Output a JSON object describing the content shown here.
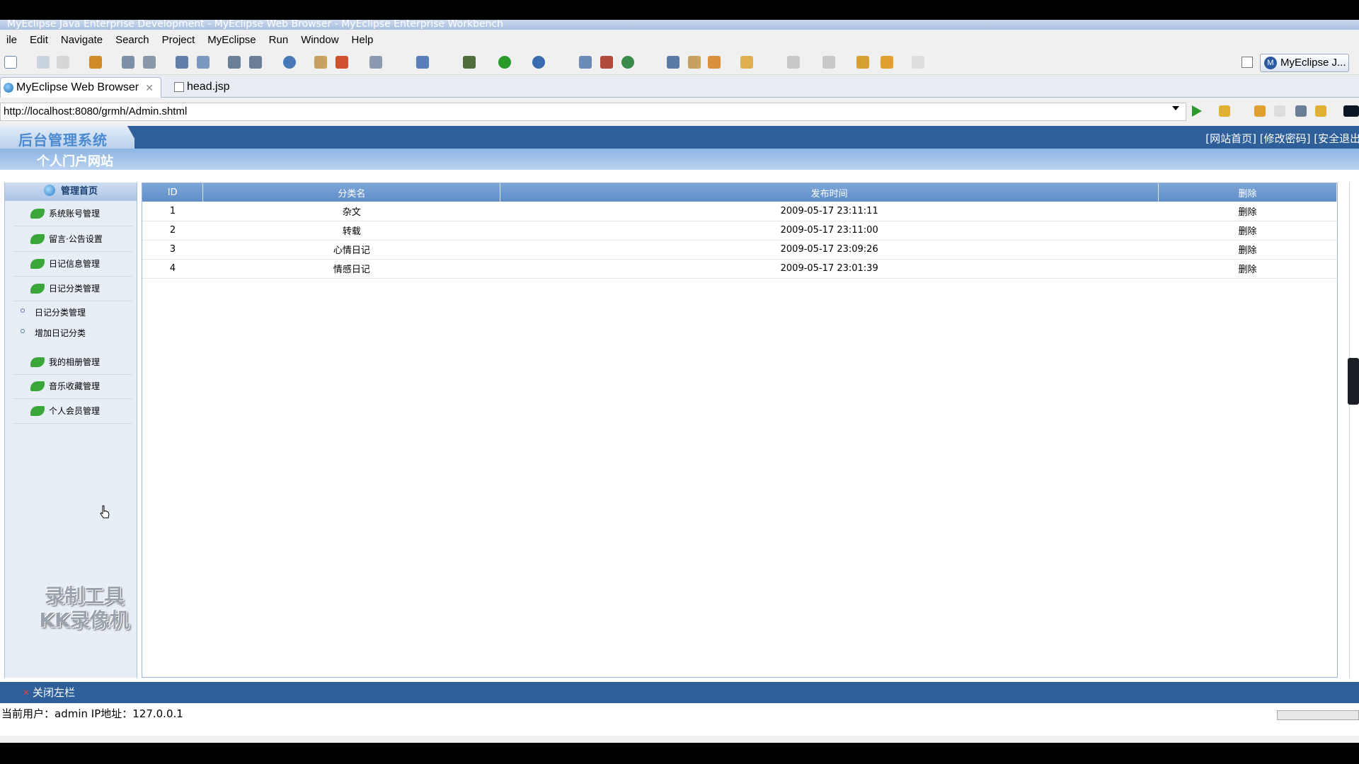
{
  "window": {
    "title": "MyEclipse Java Enterprise Development - MyEclipse Web Browser - MyEclipse Enterprise Workbench"
  },
  "menu": [
    "ile",
    "Edit",
    "Navigate",
    "Search",
    "Project",
    "MyEclipse",
    "Run",
    "Window",
    "Help"
  ],
  "perspective_label": "MyEclipse J...",
  "tabs": [
    {
      "label": "MyEclipse Web Browser"
    },
    {
      "label": "head.jsp"
    }
  ],
  "address": "http://localhost:8080/grmh/Admin.shtml",
  "page": {
    "system_title": "后台管理系统",
    "header_links": [
      "[网站首页]",
      "[修改密码]",
      "[安全退出]"
    ],
    "site_name": "个人门户网站",
    "sidebar": {
      "home_label": "管理首页",
      "items": [
        "系统账号管理",
        "留言·公告设置",
        "日记信息管理",
        "日记分类管理",
        "我的相册管理",
        "音乐收藏管理",
        "个人会员管理"
      ],
      "sub_items": [
        "日记分类管理",
        "增加日记分类"
      ]
    },
    "watermark": [
      "录制工具",
      "KK录像机"
    ],
    "table": {
      "headers": [
        "ID",
        "分类名",
        "发布时间",
        "删除"
      ],
      "rows": [
        {
          "id": "1",
          "name": "杂文",
          "time": "2009-05-17 23:11:11",
          "del": "删除"
        },
        {
          "id": "2",
          "name": "转载",
          "time": "2009-05-17 23:11:00",
          "del": "删除"
        },
        {
          "id": "3",
          "name": "心情日记",
          "time": "2009-05-17 23:09:26",
          "del": "删除"
        },
        {
          "id": "4",
          "name": "情感日记",
          "time": "2009-05-17 23:01:39",
          "del": "删除"
        }
      ]
    },
    "close_sidebar": "关闭左栏",
    "status": "当前用户：admin IP地址：127.0.0.1"
  },
  "colors": {
    "header_blue": "#2e5f9a",
    "table_header": "#6f99cf",
    "go_green": "#2b9a2b"
  }
}
